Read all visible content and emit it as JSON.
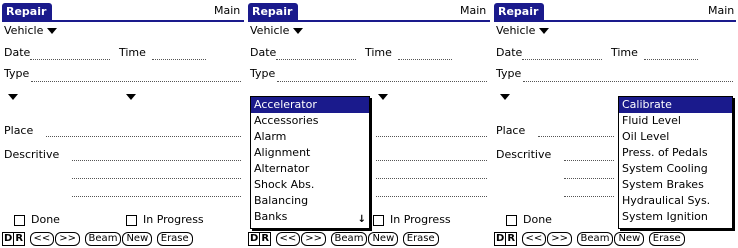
{
  "colors": {
    "accent": "#1a1a8c",
    "selection": "#1a1a8c"
  },
  "screens": [
    {
      "title": "Repair",
      "main": "Main",
      "vehicle_label": "Vehicle",
      "date_label": "Date",
      "time_label": "Time",
      "type_label": "Type",
      "place_label": "Place",
      "descriptive_label": "Descritive",
      "done_label": "Done",
      "in_progress_label": "In Progress"
    },
    {
      "title": "Repair",
      "main": "Main",
      "vehicle_label": "Vehicle",
      "date_label": "Date",
      "time_label": "Time",
      "type_label": "Type",
      "in_progress_label": "In Progress",
      "popup_items": [
        "Accelerator",
        "Accessories",
        "Alarm",
        "Alignment",
        "Alternator",
        "Shock Abs.",
        "Balancing",
        "Banks"
      ]
    },
    {
      "title": "Repair",
      "main": "Main",
      "vehicle_label": "Vehicle",
      "date_label": "Date",
      "time_label": "Time",
      "type_label": "Type",
      "place_label": "Place",
      "descriptive_label": "Descritive",
      "done_label": "Done",
      "popup_items": [
        "Calibrate",
        "Fluid Level",
        "Oil Level",
        "Press. of Pedals",
        "System Cooling",
        "System Brakes",
        "Hydraulical Sys.",
        "System Ignition"
      ]
    }
  ],
  "buttons": {
    "d": "D",
    "r": "R",
    "prev": "<<",
    "next": ">>",
    "beam": "Beam",
    "new": "New",
    "erase": "Erase"
  }
}
